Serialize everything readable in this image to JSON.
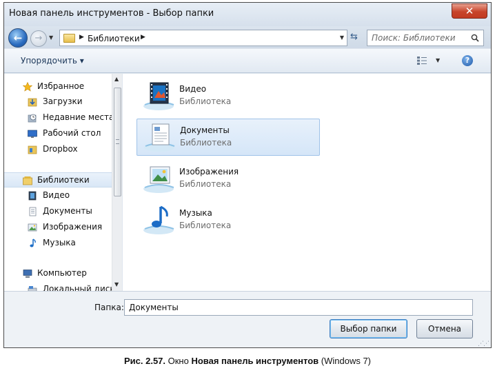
{
  "window": {
    "title": "Новая панель инструментов - Выбор папки",
    "close_label": "✕"
  },
  "nav": {
    "back_label": "←",
    "forward_label": "→",
    "address_crumb": "Библиотеки",
    "search_placeholder": "Поиск: Библиотеки"
  },
  "toolbar": {
    "organize_label": "Упорядочить ▾",
    "help_label": "?"
  },
  "sidebar": {
    "favorites": {
      "label": "Избранное",
      "items": [
        {
          "label": "Загрузки"
        },
        {
          "label": "Недавние места"
        },
        {
          "label": "Рабочий стол"
        },
        {
          "label": "Dropbox"
        }
      ]
    },
    "libraries": {
      "label": "Библиотеки",
      "items": [
        {
          "label": "Видео"
        },
        {
          "label": "Документы"
        },
        {
          "label": "Изображения"
        },
        {
          "label": "Музыка"
        }
      ]
    },
    "computer": {
      "label": "Компьютер",
      "items": [
        {
          "label": "Локальный диск"
        }
      ]
    }
  },
  "libraries": [
    {
      "name": "Видео",
      "type": "Библиотека"
    },
    {
      "name": "Документы",
      "type": "Библиотека"
    },
    {
      "name": "Изображения",
      "type": "Библиотека"
    },
    {
      "name": "Музыка",
      "type": "Библиотека"
    }
  ],
  "footer": {
    "folder_label": "Папка:",
    "folder_value": "Документы",
    "select_button": "Выбор папки",
    "cancel_button": "Отмена"
  },
  "caption": {
    "number": "Рис. 2.57.",
    "text1": " Окно ",
    "bold": "Новая панель инструментов",
    "text2": " (Windows 7)"
  },
  "colors": {
    "window_frame": "#dfe6ee",
    "selection": "#d5e6f8",
    "close_button": "#c7442b"
  }
}
